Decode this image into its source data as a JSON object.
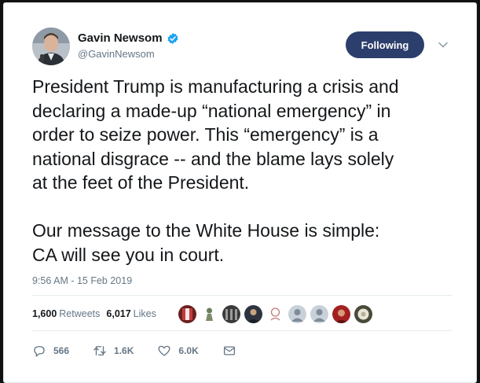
{
  "tweet": {
    "author_name": "Gavin Newsom",
    "author_handle": "@GavinNewsom",
    "follow_label": "Following",
    "text": "President Trump is manufacturing a crisis and\ndeclaring a made-up “national emergency” in\norder to seize power. This “emergency” is a\nnational disgrace -- and the blame lays solely\nat the feet of the President.\n\nOur message to the White House is simple:\nCA will see you in court.",
    "timestamp": "9:56 AM - 15 Feb 2019",
    "stats": {
      "retweets_count": "1,600",
      "retweets_label": "Retweets",
      "likes_count": "6,017",
      "likes_label": "Likes"
    },
    "actions": {
      "replies": "566",
      "retweets": "1.6K",
      "likes": "6.0K"
    },
    "icons": {
      "verified": "verified-badge-icon",
      "caret": "chevron-down-icon",
      "reply": "reply-icon",
      "retweet": "retweet-icon",
      "like": "heart-icon",
      "dm": "envelope-icon"
    },
    "colors": {
      "follow_button": "#2c3e6b",
      "verified": "#1da1f2",
      "muted_text": "#657786",
      "body_text": "#14171a"
    }
  }
}
